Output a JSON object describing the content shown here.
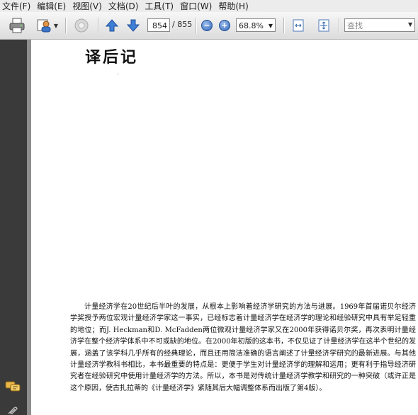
{
  "menu": [
    "文件(F)",
    "编辑(E)",
    "视图(V)",
    "文档(D)",
    "工具(T)",
    "窗口(W)",
    "帮助(H)"
  ],
  "toolbar": {
    "page_current": "854",
    "page_total": "/ 855",
    "zoom": "68.8%",
    "search_placeholder": "查找"
  },
  "icons": [
    "print-icon",
    "share-icon",
    "settings-icon",
    "prev-page-icon",
    "next-page-icon",
    "zoom-out-icon",
    "zoom-in-icon",
    "fit-page-icon",
    "fit-width-icon",
    "comments-icon",
    "attachment-icon"
  ],
  "document": {
    "heading": "译后记",
    "paragraph": "计量经济学在20世纪后半叶的发展，从根本上影响着经济学研究的方法与进展。1969年首届诺贝尔经济学奖授予两位宏观计量经济学家这一事实，已经标志着计量经济学在经济学的理论和经验研究中具有举足轻重的地位；而J. Heckman和D. McFadden两位微观计量经济学家又在2000年获得诺贝尔奖，再次表明计量经济学在整个经济学体系中不可或缺的地位。在2000年初版的这本书，不仅见证了计量经济学在这半个世纪的发展，涵盖了该学科几乎所有的经典理论，而且还用简洁准确的语言阐述了计量经济学研究的最新进展。与其他计量经济学教科书相比，本书最重要的特点是：更便于学生对计量经济学的理解和运用；更有利于指导经济研究者在经验研究中使用计量经济学的方法。所以，本书是对传统计量经济学教学和研究的一种突破（或许正是这个原因，使古扎拉蒂的《计量经济学》紧随其后大幅调整体系而出版了第4版）。"
  }
}
